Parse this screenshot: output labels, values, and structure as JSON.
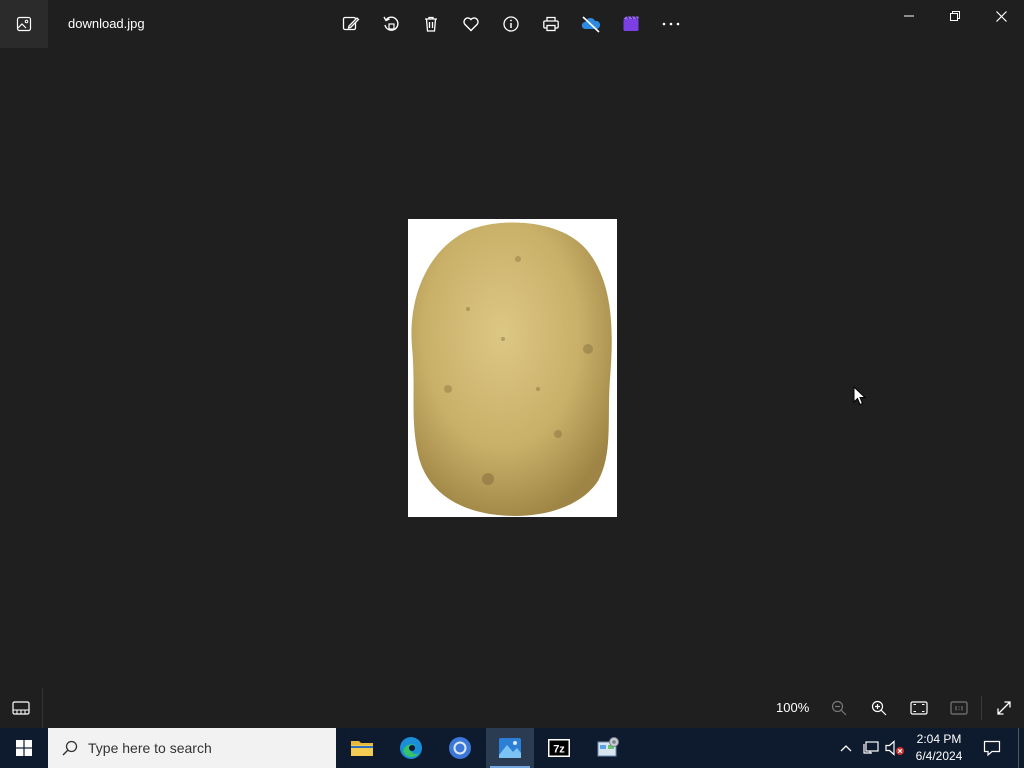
{
  "window": {
    "title": "download.jpg"
  },
  "toolbar": {
    "buttons": [
      {
        "name": "edit-image",
        "icon": "edit-pen-icon"
      },
      {
        "name": "rotate",
        "icon": "rotate-icon"
      },
      {
        "name": "delete",
        "icon": "trash-icon"
      },
      {
        "name": "favorite",
        "icon": "heart-icon"
      },
      {
        "name": "file-info",
        "icon": "info-icon"
      },
      {
        "name": "print",
        "icon": "printer-icon"
      },
      {
        "name": "onedrive",
        "icon": "cloud-off-icon"
      },
      {
        "name": "clipchamp",
        "icon": "clipchamp-icon"
      },
      {
        "name": "more",
        "icon": "more-dots-icon"
      }
    ]
  },
  "statusbar": {
    "zoom_label": "100%"
  },
  "taskbar": {
    "search_placeholder": "Type here to search",
    "time": "2:04 PM",
    "date": "6/4/2024"
  },
  "colors": {
    "background": "#1f1f1f",
    "taskbar": "#0e1a2e",
    "accent": "#76a6e0"
  }
}
